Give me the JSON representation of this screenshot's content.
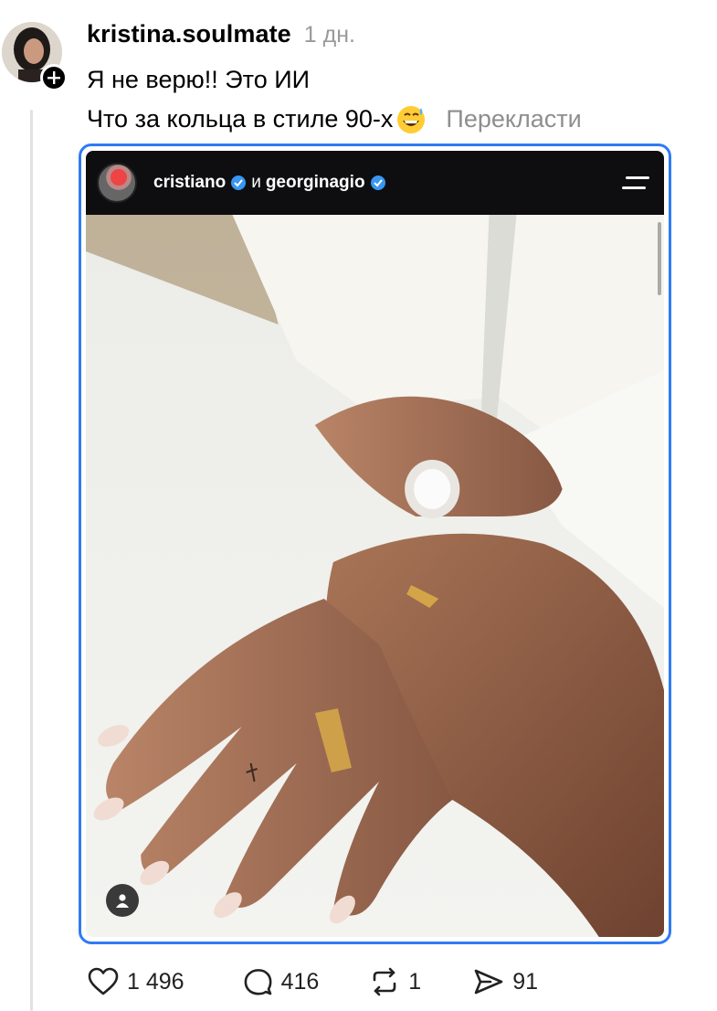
{
  "post": {
    "username": "kristina.soulmate",
    "time": "1 дн.",
    "text_line1": "Я не верю!! Это ИИ",
    "text_line2": "Что за кольца в стиле 90-х",
    "emoji": "grinning-sweat-emoji",
    "translate_label": "Перекласти"
  },
  "embedded_story": {
    "user1": "cristiano",
    "connector": "и",
    "user2": "georginagio",
    "verified_color": "#3897f0"
  },
  "actions": {
    "likes": "1 496",
    "comments": "416",
    "reposts": "1",
    "shares": "91"
  },
  "colors": {
    "accent_border": "#2f7bf5",
    "muted_text": "#9a9a9a"
  }
}
